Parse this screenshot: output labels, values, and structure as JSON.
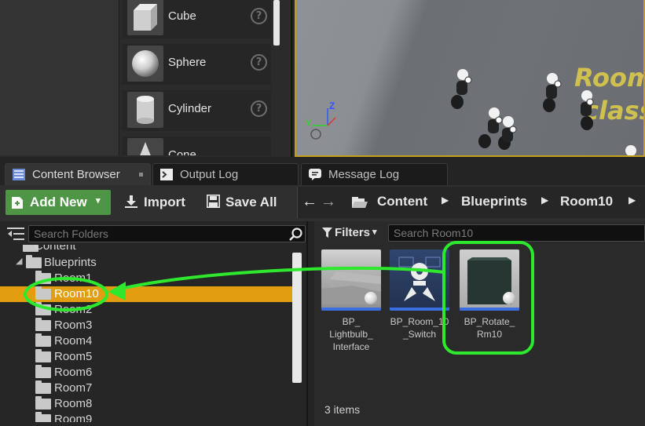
{
  "place_actors": {
    "items": [
      {
        "label": "Cube"
      },
      {
        "label": "Sphere"
      },
      {
        "label": "Cylinder"
      },
      {
        "label": "Cone"
      }
    ]
  },
  "viewport": {
    "overlay_text_line1": "Room",
    "overlay_text_line2": "class",
    "axis_z": "Z",
    "axis_y": "Y"
  },
  "tabs": [
    {
      "label": "Content Browser",
      "active": true
    },
    {
      "label": "Output Log",
      "active": false
    },
    {
      "label": "Message Log",
      "active": false
    }
  ],
  "toolbar": {
    "add_new_label": "Add New",
    "import_label": "Import",
    "save_all_label": "Save All"
  },
  "breadcrumb": [
    "Content",
    "Blueprints",
    "Room10"
  ],
  "folders": {
    "search_placeholder": "Search Folders",
    "tree": [
      {
        "label": "Content",
        "indent": 0
      },
      {
        "label": "Blueprints",
        "indent": 1
      },
      {
        "label": "Room1",
        "indent": 2
      },
      {
        "label": "Room10",
        "indent": 2,
        "selected": true
      },
      {
        "label": "Room2",
        "indent": 2
      },
      {
        "label": "Room3",
        "indent": 2
      },
      {
        "label": "Room4",
        "indent": 2
      },
      {
        "label": "Room5",
        "indent": 2
      },
      {
        "label": "Room6",
        "indent": 2
      },
      {
        "label": "Room7",
        "indent": 2
      },
      {
        "label": "Room8",
        "indent": 2
      },
      {
        "label": "Room9",
        "indent": 2
      }
    ]
  },
  "assets": {
    "filters_label": "Filters",
    "search_placeholder": "Search Room10",
    "items": [
      {
        "line1": "BP_",
        "line2": "Lightbulb_",
        "line3": "Interface"
      },
      {
        "line1": "BP_Room_10",
        "line2": "_Switch",
        "line3": ""
      },
      {
        "line1": "BP_Rotate_",
        "line2": "Rm10",
        "line3": ""
      }
    ],
    "item_count": "3 items"
  },
  "colors": {
    "accent_green": "#4e9646",
    "selection_orange": "#e39e10",
    "annotation_green": "#2ee82e",
    "asset_bar_blue": "#3b6ee0"
  }
}
